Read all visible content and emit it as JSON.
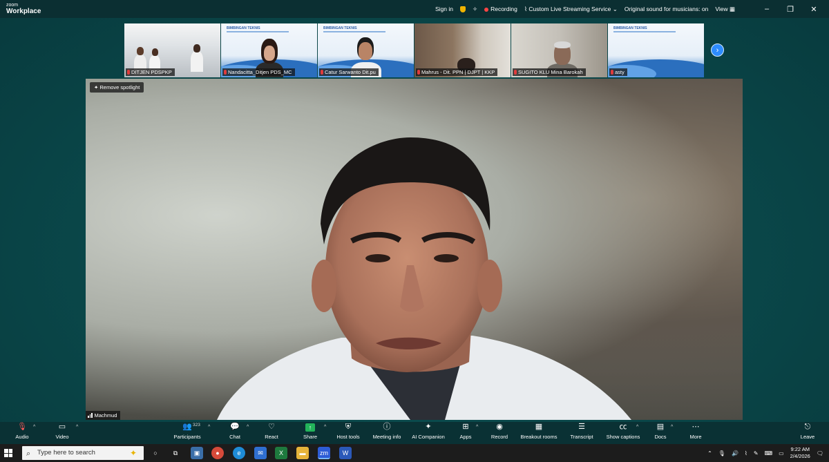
{
  "app": {
    "logo_top": "zoom",
    "logo_bottom": "Workplace"
  },
  "topbar": {
    "sign_in": "Sign in",
    "recording": "Recording",
    "streaming": "Custom Live Streaming Service",
    "original_sound": "Original sound for musicians: on",
    "view": "View"
  },
  "thumbnails": [
    {
      "name": "DITJEN PDSPKP",
      "kind": "room"
    },
    {
      "name": "Nandacitta_Ditjen PDS_MC",
      "kind": "slide-person"
    },
    {
      "name": "Catur Sarwanto Dit.pu",
      "kind": "slide-person"
    },
    {
      "name": "Mahrus - Dit. PPN | DJPT | KKP",
      "kind": "office"
    },
    {
      "name": "SUGITO KLU Mina Barokah",
      "kind": "office"
    },
    {
      "name": "asty",
      "kind": "slide"
    }
  ],
  "slide_heading": "BIMBINGAN TEKNIS",
  "main": {
    "remove_spotlight": "Remove spotlight",
    "speaker_name": "Machmud"
  },
  "toolbar": {
    "audio": "Audio",
    "video": "Video",
    "participants": "Participants",
    "participant_count": "323",
    "chat": "Chat",
    "react": "React",
    "share": "Share",
    "host_tools": "Host tools",
    "meeting_info": "Meeting info",
    "ai_companion": "AI Companion",
    "apps": "Apps",
    "record": "Record",
    "breakout_rooms": "Breakout rooms",
    "transcript": "Transcript",
    "show_captions": "Show captions",
    "docs": "Docs",
    "more": "More",
    "leave": "Leave"
  },
  "taskbar": {
    "search_placeholder": "Type here to search",
    "time": "9:22 AM",
    "date": "2/4/2026"
  },
  "colors": {
    "share_green": "#22b35a",
    "recording_red": "#ff4545",
    "accent_blue": "#2d8cff",
    "background_teal": "#0a4a4c"
  }
}
